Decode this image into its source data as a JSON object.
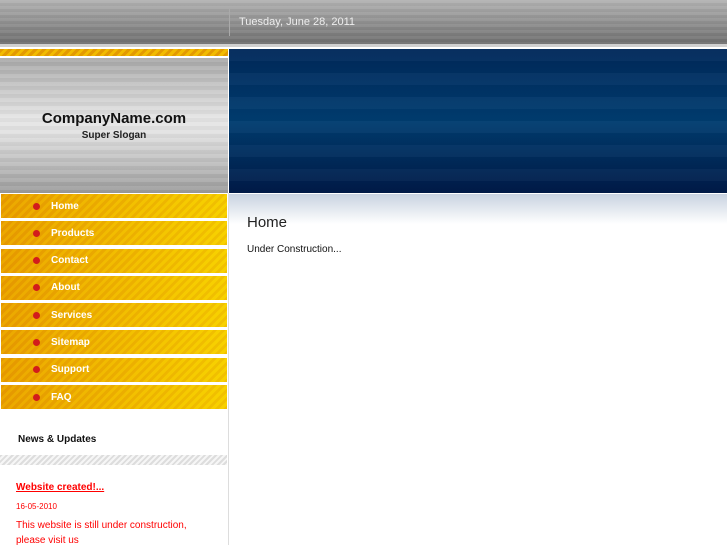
{
  "header": {
    "date": "Tuesday, June 28, 2011"
  },
  "logo": {
    "name": "CompanyName.com",
    "slogan": "Super Slogan"
  },
  "nav": [
    {
      "label": "Home"
    },
    {
      "label": "Products"
    },
    {
      "label": "Contact"
    },
    {
      "label": "About"
    },
    {
      "label": "Services"
    },
    {
      "label": "Sitemap"
    },
    {
      "label": "Support"
    },
    {
      "label": "FAQ"
    }
  ],
  "news": {
    "heading": "News & Updates",
    "title": "Website created!...",
    "date": "16-05-2010",
    "text": "This website is still under construction, please visit us"
  },
  "content": {
    "title": "Home",
    "text": "Under Construction..."
  }
}
